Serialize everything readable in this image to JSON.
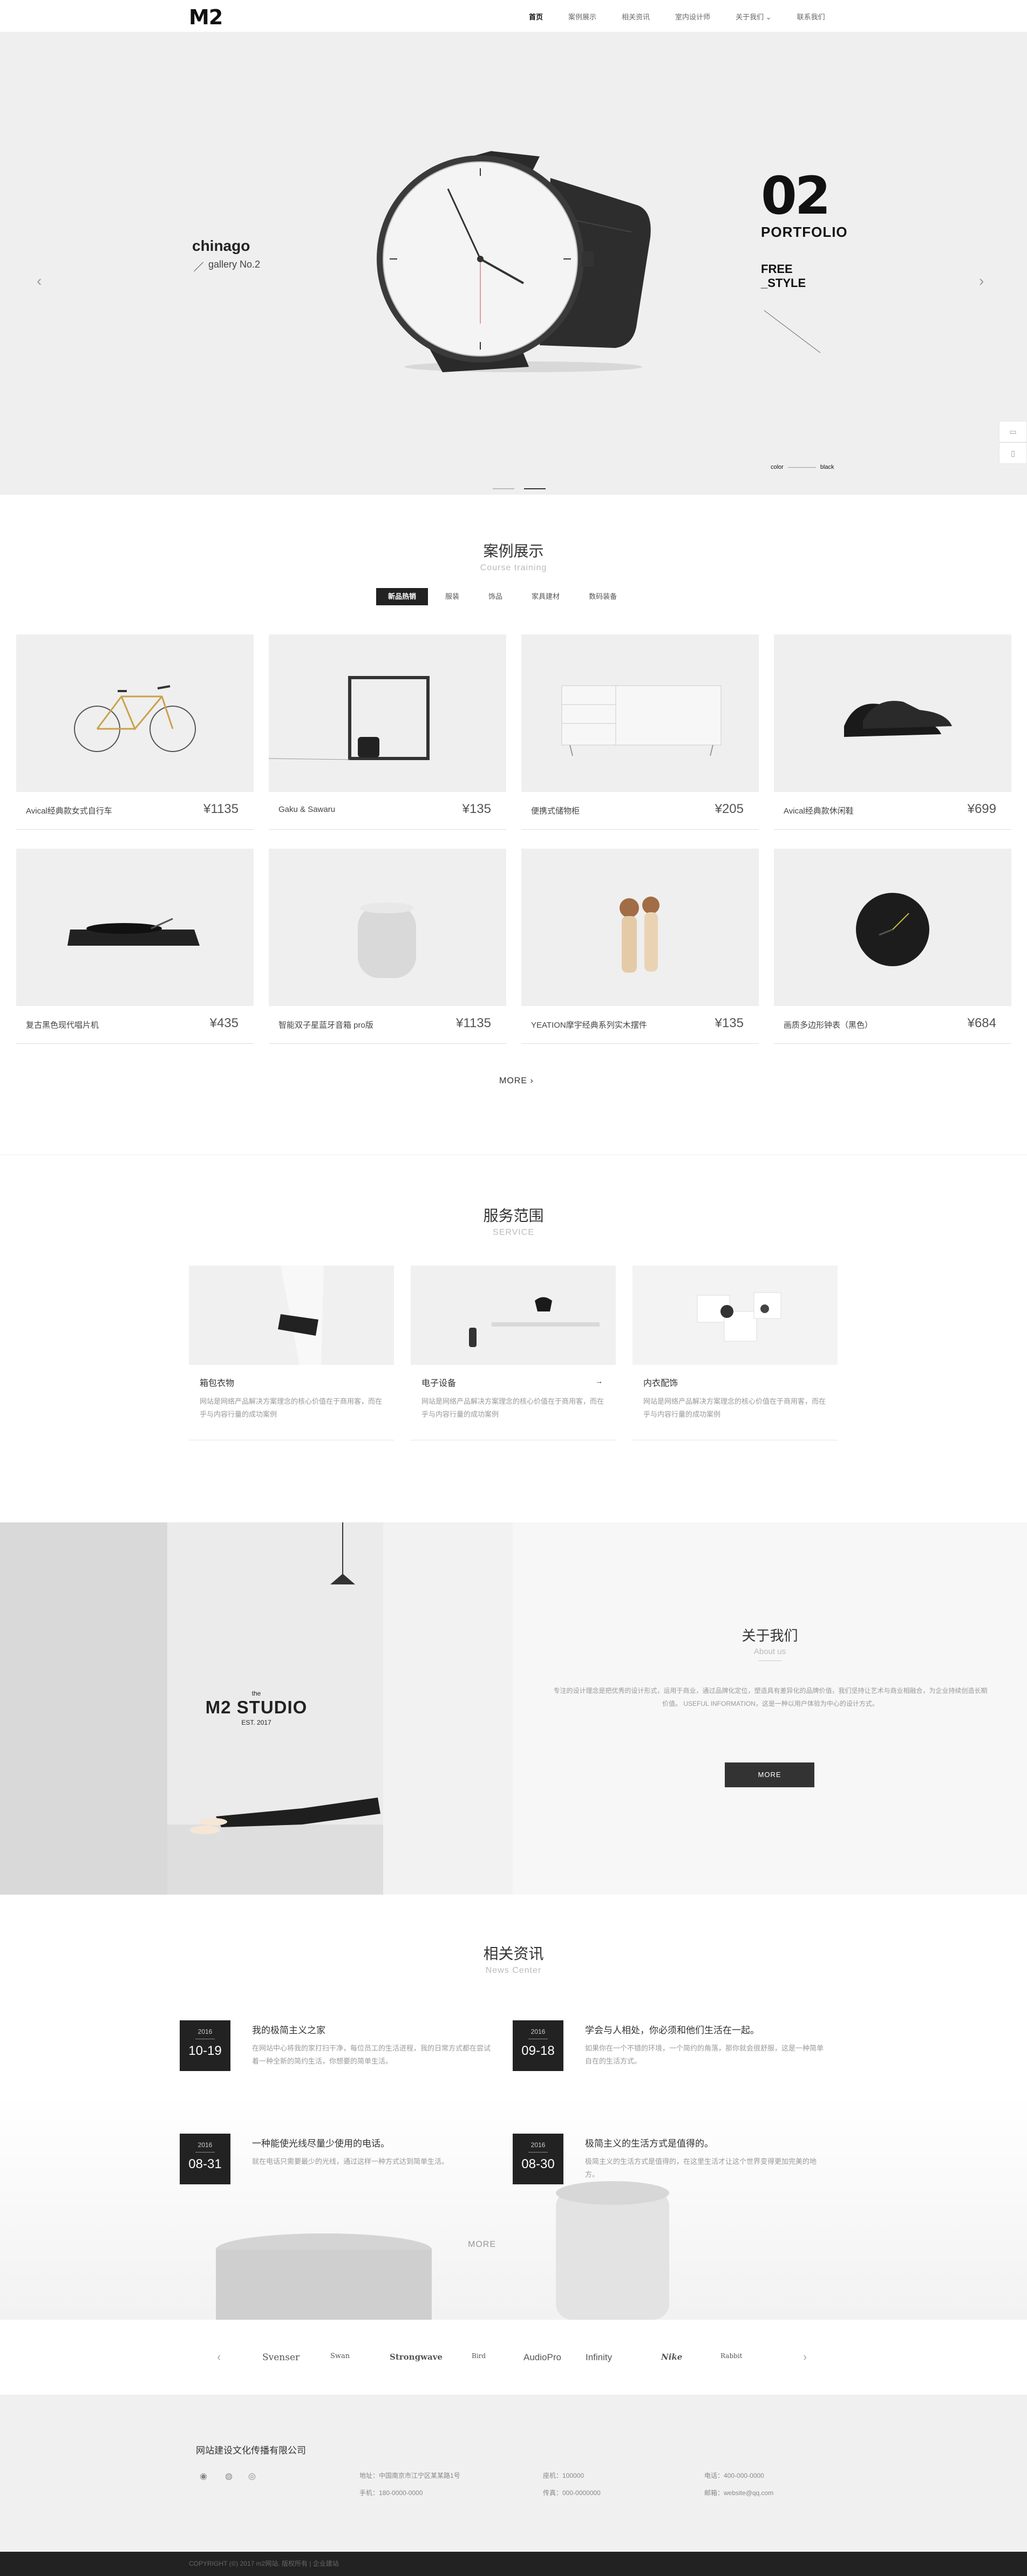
{
  "header": {
    "logo": "M2",
    "nav": [
      "首页",
      "案例展示",
      "相关资讯",
      "室内设计师",
      "关于我们 ⌄",
      "联系我们"
    ]
  },
  "hero": {
    "left_title": "chinago",
    "left_sub": "gallery No.2",
    "number": "02",
    "portfolio": "PORTFOLIO",
    "free": "FREE",
    "style": "_STYLE",
    "color_label": "color",
    "color_value": "black",
    "prev": "‹",
    "next": "›"
  },
  "cases": {
    "title": "案例展示",
    "subtitle": "Course training",
    "tabs": [
      "新品热销",
      "服装",
      "饰品",
      "家具建材",
      "数码装备"
    ],
    "items": [
      {
        "name": "Avical经典款女式自行车",
        "price": "¥1135"
      },
      {
        "name": "Gaku & Sawaru",
        "price": "¥135"
      },
      {
        "name": "便携式储物柜",
        "price": "¥205"
      },
      {
        "name": "Avical经典款休闲鞋",
        "price": "¥699"
      },
      {
        "name": "复古黑色现代唱片机",
        "price": "¥435"
      },
      {
        "name": "智能双子星蓝牙音箱 pro版",
        "price": "¥1135"
      },
      {
        "name": "YEATION摩宇经典系列实木摆件",
        "price": "¥135"
      },
      {
        "name": "画质多边形钟表（黑色）",
        "price": "¥684"
      }
    ],
    "more": "MORE  ›"
  },
  "service": {
    "title": "服务范围",
    "subtitle": "SERVICE",
    "items": [
      {
        "title": "箱包衣物",
        "desc": "网站是网络产品解决方案理念的核心价值在于商用客，而在乎与内容行量的成功案例"
      },
      {
        "title": "电子设备",
        "desc": "网站是网络产品解决方案理念的核心价值在于商用客，而在乎与内容行量的成功案例"
      },
      {
        "title": "内衣配饰",
        "desc": "网站是网络产品解决方案理念的核心价值在于商用客，而在乎与内容行量的成功案例"
      }
    ]
  },
  "about": {
    "studio_the": "the",
    "studio_name": "M2 STUDIO",
    "studio_est": "EST. 2017",
    "title": "关于我们",
    "subtitle": "About us",
    "desc": "专注的设计理念是把优秀的设计形式，运用于商业，通过品牌化定位，塑造具有差异化的品牌价值，我们坚持让艺术与商业相融合，为企业持续创造长期价值。 USEFUL INFORMATION，这是一种以用户体验为中心的设计方式。",
    "more": "MORE"
  },
  "news": {
    "title": "相关资讯",
    "subtitle": "News Center",
    "items": [
      {
        "year": "2016",
        "date": "10-19",
        "title": "我的极简主义之家",
        "desc": "在网站中心将我的家打扫干净，每位员工的生活进程，我的日常方式都在尝试着一种全新的简约生活，你想要的简单生活。"
      },
      {
        "year": "2016",
        "date": "09-18",
        "title": "学会与人相处，你必须和他们生活在一起。",
        "desc": "如果你在一个不错的环境，一个简约的角落，那你就会很舒服，这是一种简单自在的生活方式。"
      },
      {
        "year": "2016",
        "date": "08-31",
        "title": "一种能使光线尽量少使用的电话。",
        "desc": "就在电话只需要最少的光线，通过这样一种方式达到简单生活。"
      },
      {
        "year": "2016",
        "date": "08-30",
        "title": "极简主义的生活方式是值得的。",
        "desc": "极简主义的生活方式是值得的，在这里生活才让这个世界变得更加完美的地方。"
      }
    ],
    "more": "MORE"
  },
  "partners": [
    "Svenser",
    "Swan",
    "Strongwave",
    "Bird",
    "AudioPro",
    "Infinity",
    "Nike",
    "Rabbit"
  ],
  "footer": {
    "company": "网站建设文化传播有限公司",
    "address": "地址：中国南京市江宁区某某路1号",
    "phone": "手机：180-0000-0000",
    "tel": "座机：100000",
    "fax": "传真：000-0000000",
    "service": "电话：400-000-0000",
    "email": "邮箱：website@qq.com",
    "copyright": "COPYRIGHT (©) 2017 m2网站. 版权所有 | 企业建站"
  }
}
